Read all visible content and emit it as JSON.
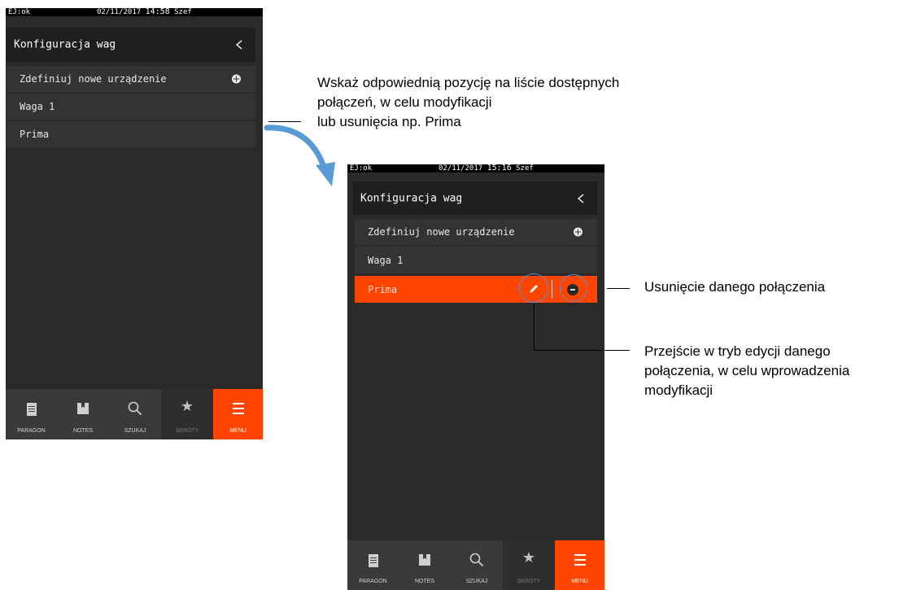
{
  "screen_left": {
    "status": {
      "left": "EJ:ok",
      "date": "02/11/2017",
      "time": "14:58",
      "user": "Szef"
    },
    "header": {
      "title": "Konfiguracja wag"
    },
    "rows": [
      {
        "label": "Zdefiniuj nowe urządzenie"
      },
      {
        "label": "Waga 1"
      },
      {
        "label": "Prima"
      }
    ],
    "tabs": [
      "PARAGON",
      "NOTES",
      "SZUKAJ",
      "SKRÓTY",
      "MENU"
    ]
  },
  "screen_right": {
    "status": {
      "left": "EJ:ok",
      "date": "02/11/2017",
      "time": "15:16",
      "user": "Szef"
    },
    "header": {
      "title": "Konfiguracja wag"
    },
    "rows": [
      {
        "label": "Zdefiniuj nowe urządzenie"
      },
      {
        "label": "Waga 1"
      },
      {
        "label": "Prima",
        "selected": true
      }
    ],
    "tabs": [
      "PARAGON",
      "NOTES",
      "SZUKAJ",
      "SKRÓTY",
      "MENU"
    ]
  },
  "callouts": {
    "select_item": [
      "Wskaż odpowiednią pozycję na liście dostępnych",
      "połączeń, w celu modyfikacji",
      "lub usunięcia np. Prima"
    ],
    "delete": "Usunięcie danego połączenia",
    "edit": [
      "Przejście w tryb edycji danego",
      "połączenia, w celu wprowadzenia",
      "modyfikacji"
    ]
  },
  "colors": {
    "accent": "#ff4500",
    "screen_bg": "#2a2a2a",
    "row_bg": "#333333",
    "highlight": "#5b8cd6",
    "arrow": "#5b9bd5"
  },
  "icons": {
    "back": "chevron-left-icon",
    "add": "plus-circle-icon",
    "edit": "pencil-icon",
    "delete": "minus-circle-icon",
    "arrow": "curved-arrow-icon"
  }
}
